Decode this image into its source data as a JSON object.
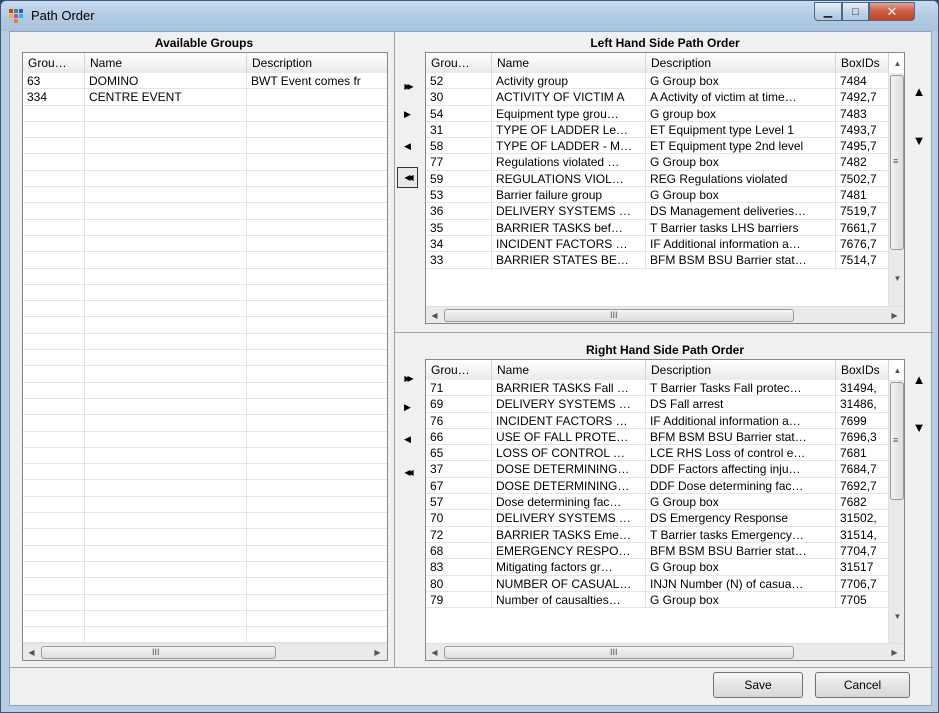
{
  "window": {
    "title": "Path Order"
  },
  "available": {
    "title": "Available Groups",
    "columns": [
      "Grou…",
      "Name",
      "Description"
    ],
    "rows": [
      [
        "63",
        "DOMINO",
        "BWT  Event comes fr"
      ],
      [
        "334",
        "CENTRE EVENT",
        ""
      ]
    ]
  },
  "lhs": {
    "title": "Left Hand Side Path Order",
    "columns": [
      "Grou…",
      "Name",
      "Description",
      "BoxIDs"
    ],
    "rows": [
      [
        "52",
        "Activity group",
        "G Group box",
        "7484"
      ],
      [
        "30",
        "ACTIVITY OF VICTIM A",
        "A Activity of victim at time…",
        "7492,7"
      ],
      [
        "54",
        "Equipment type grou…",
        "G group box",
        "7483"
      ],
      [
        "31",
        "TYPE OF LADDER Le…",
        "ET Equipment type Level 1",
        "7493,7"
      ],
      [
        "58",
        "TYPE OF LADDER - M…",
        "ET Equipment type 2nd level",
        "7495,7"
      ],
      [
        "77",
        "Regulations violated …",
        "G Group box",
        "7482"
      ],
      [
        "59",
        "REGULATIONS VIOL…",
        "REG Regulations violated",
        "7502,7"
      ],
      [
        "53",
        "Barrier failure group",
        "G Group box",
        "7481"
      ],
      [
        "36",
        "DELIVERY SYSTEMS …",
        "DS Management deliveries…",
        "7519,7"
      ],
      [
        "35",
        "BARRIER TASKS bef…",
        "T Barrier tasks  LHS barriers",
        "7661,7"
      ],
      [
        "34",
        "INCIDENT FACTORS …",
        "IF Additional information a…",
        "7676,7"
      ],
      [
        "33",
        "BARRIER STATES BE…",
        "BFM BSM BSU Barrier stat…",
        "7514,7"
      ]
    ]
  },
  "rhs": {
    "title": "Right Hand Side Path Order",
    "columns": [
      "Grou…",
      "Name",
      "Description",
      "BoxIDs"
    ],
    "rows": [
      [
        "71",
        "BARRIER TASKS Fall …",
        "T Barrier Tasks Fall protec…",
        "31494,"
      ],
      [
        "69",
        "DELIVERY SYSTEMS …",
        "DS Fall arrest",
        "31486,"
      ],
      [
        "76",
        "INCIDENT FACTORS …",
        "IF Additional information a…",
        "7699"
      ],
      [
        "66",
        "USE OF FALL PROTE…",
        "BFM BSM BSU Barrier stat…",
        "7696,3"
      ],
      [
        "65",
        "LOSS OF CONTROL …",
        "LCE RHS Loss of control e…",
        "7681"
      ],
      [
        "37",
        "DOSE DETERMINING…",
        "DDF Factors affecting inju…",
        "7684,7"
      ],
      [
        "67",
        "DOSE DETERMINING…",
        "DDF Dose determining fac…",
        "7692,7"
      ],
      [
        "57",
        "Dose determining fac…",
        "G Group box",
        "7682"
      ],
      [
        "70",
        "DELIVERY SYSTEMS …",
        "DS Emergency Response",
        "31502,"
      ],
      [
        "72",
        "BARRIER TASKS Eme…",
        "T Barrier tasks Emergency…",
        "31514,"
      ],
      [
        "68",
        "EMERGENCY RESPO…",
        "BFM BSM BSU Barrier stat…",
        "7704,7"
      ],
      [
        "83",
        "Mitigating factors gr…",
        "G Group box",
        "31517"
      ],
      [
        "80",
        "NUMBER OF CASUAL…",
        "INJN Number (N) of casua…",
        "7706,7"
      ],
      [
        "79",
        "Number of causalties…",
        "G Group box",
        "7705"
      ]
    ]
  },
  "scroll": {
    "grip": "III"
  },
  "icons": {
    "move_all_right": "▶▶",
    "move_right": "▶",
    "move_left": "◀",
    "move_all_left": "◀◀",
    "up": "▲",
    "down": "▼"
  },
  "buttons": {
    "save": "Save",
    "cancel": "Cancel"
  },
  "colors": {
    "title_bar": "#b3cbe4",
    "close": "#c04428"
  }
}
